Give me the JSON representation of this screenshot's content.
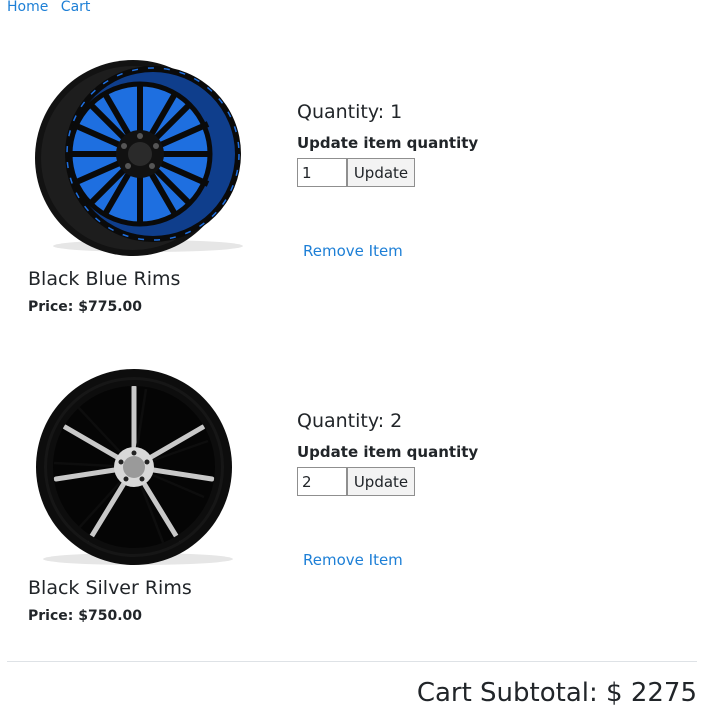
{
  "nav": {
    "home": "Home",
    "cart": "Cart"
  },
  "items": [
    {
      "name": "Black Blue Rims",
      "price": "Price: $775.00",
      "quantity_title": "Quantity: 1",
      "update_label": "Update item quantity",
      "quantity_value": "1",
      "update_button": "Update",
      "remove_link": "Remove Item"
    },
    {
      "name": "Black Silver Rims",
      "price": "Price: $750.00",
      "quantity_title": "Quantity: 2",
      "update_label": "Update item quantity",
      "quantity_value": "2",
      "update_button": "Update",
      "remove_link": "Remove Item"
    }
  ],
  "cart": {
    "subtotal": "Cart Subtotal: $ 2275"
  },
  "colors": {
    "link": "#1d7fd6",
    "rim_accent_1": "#1e6fe0",
    "rim_accent_2": "#c9c9c9"
  }
}
